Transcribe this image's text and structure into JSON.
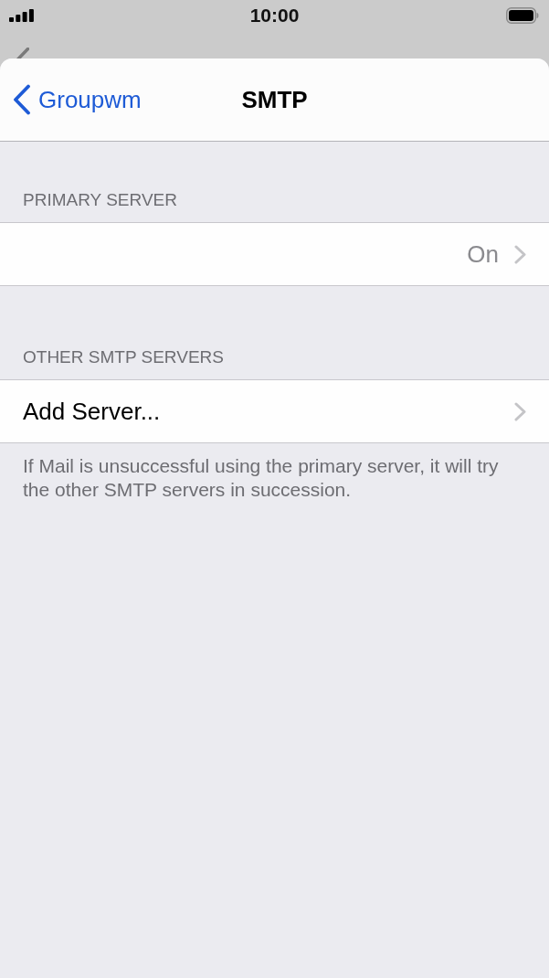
{
  "status_bar": {
    "time": "10:00"
  },
  "nav": {
    "back": "Groupwm",
    "title": "SMTP"
  },
  "sections": [
    {
      "header": "PRIMARY SERVER",
      "rows": [
        {
          "value": "On",
          "disclosure": true
        }
      ]
    },
    {
      "header": "OTHER SMTP SERVERS",
      "rows": [
        {
          "label": "Add Server...",
          "disclosure": true
        }
      ],
      "footer": "If Mail is unsuccessful using the primary server, it will try the other SMTP servers in succession."
    }
  ]
}
